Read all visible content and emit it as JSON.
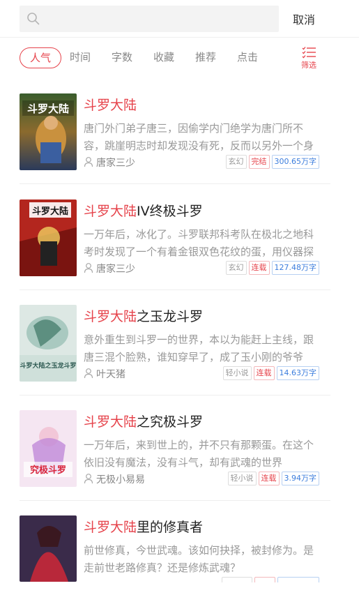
{
  "search": {
    "placeholder": "",
    "cancel_label": "取消"
  },
  "filters": {
    "tabs": [
      "人气",
      "时间",
      "字数",
      "收藏",
      "推荐",
      "点击"
    ],
    "active_index": 0,
    "filter_label": "筛选"
  },
  "books": [
    {
      "title_highlight": "斗罗大陆",
      "title_rest": "",
      "desc": "唐门外门弟子唐三，因偷学内门绝学为唐门所不容，跳崖明志时却发现没有死，反而以另外一个身份来到了另一个世界",
      "author": "唐家三少",
      "tags": [
        "玄幻",
        "完结",
        "300.65万字"
      ],
      "cover_text": "斗罗大陆"
    },
    {
      "title_highlight": "斗罗大陆",
      "title_rest": "IV终极斗罗",
      "desc": "一万年后，冰化了。斗罗联邦科考队在极北之地科考时发现了一个有着金银双色花纹的蛋，用仪器探察之后",
      "author": "唐家三少",
      "tags": [
        "玄幻",
        "连载",
        "127.48万字"
      ],
      "cover_text": "斗罗大陆"
    },
    {
      "title_highlight": "斗罗大陆",
      "title_rest": "之玉龙斗罗",
      "desc": "意外重生到斗罗一的世界，本以为能赶上主线，跟唐三混个脸熟，谁知穿早了，成了玉小刚的爷爷",
      "author": "叶天猪",
      "tags": [
        "轻小说",
        "连载",
        "14.63万字"
      ],
      "cover_text": "斗罗大陆之玉龙斗罗"
    },
    {
      "title_highlight": "斗罗大陆",
      "title_rest": "之究极斗罗",
      "desc": "一万年后，来到世上的，并不只有那颗蛋。在这个依旧没有魔法，没有斗气，却有武魂的世界",
      "author": "无极小易易",
      "tags": [
        "轻小说",
        "连载",
        "3.94万字"
      ],
      "cover_text": "究极斗罗"
    },
    {
      "title_highlight": "斗罗大陆",
      "title_rest": "里的修真者",
      "desc": "前世修真，今世武魂。该如何抉择，被封修为。是走前世老路修真？还是修炼武魂？",
      "author": "",
      "tags": [
        "",
        "",
        ""
      ],
      "cover_text": ""
    }
  ]
}
